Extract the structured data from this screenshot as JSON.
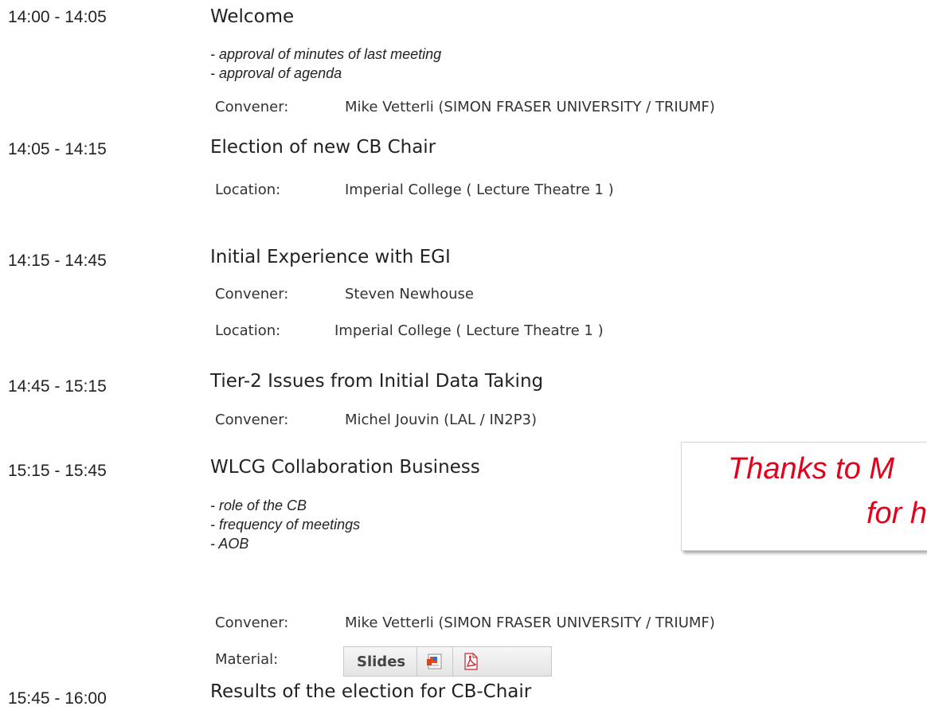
{
  "agenda": [
    {
      "time": "14:00 - 14:05",
      "title": "Welcome",
      "description": [
        "- approval of minutes of last meeting",
        "- approval of agenda"
      ],
      "convener_label": "Convener:",
      "convener": "Mike Vetterli (SIMON FRASER UNIVERSITY / TRIUMF)"
    },
    {
      "time": "14:05 - 14:15",
      "title": "Election of new CB Chair",
      "location_label": "Location:",
      "location": "Imperial College ( Lecture Theatre 1 )"
    },
    {
      "time": "14:15 - 14:45",
      "title": "Initial Experience with EGI",
      "convener_label": "Convener:",
      "convener": "Steven Newhouse",
      "location_label": "Location:",
      "location": "Imperial College ( Lecture Theatre 1 )"
    },
    {
      "time": "14:45 - 15:15",
      "title": "Tier-2 Issues from Initial Data Taking",
      "convener_label": "Convener:",
      "convener": "Michel Jouvin (LAL / IN2P3)"
    },
    {
      "time": "15:15 - 15:45",
      "title": "WLCG Collaboration Business",
      "description": [
        "- role of the CB",
        "- frequency of meetings",
        "- AOB"
      ],
      "convener_label": "Convener:",
      "convener": "Mike Vetterli (SIMON FRASER UNIVERSITY / TRIUMF)",
      "material_label": "Material:",
      "material_button": "Slides",
      "material_icons": [
        "powerpoint-icon",
        "pdf-icon"
      ]
    },
    {
      "time": "15:45 - 16:00",
      "title": "Results of the election for CB-Chair"
    }
  ],
  "callout": {
    "line1": "Thanks to M",
    "line2": "for h"
  },
  "colors": {
    "callout_text": "#e4001b",
    "text": "#222222",
    "label": "#333333"
  }
}
